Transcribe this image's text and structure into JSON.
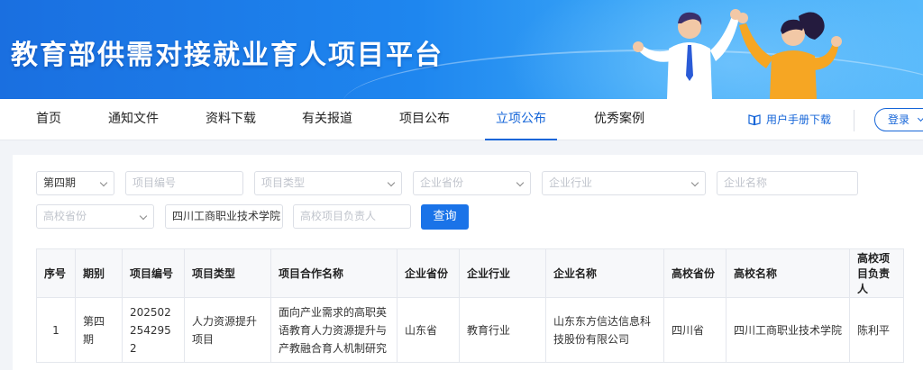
{
  "banner": {
    "title": "教育部供需对接就业育人项目平台"
  },
  "nav": {
    "items": [
      {
        "label": "首页"
      },
      {
        "label": "通知文件"
      },
      {
        "label": "资料下载"
      },
      {
        "label": "有关报道"
      },
      {
        "label": "项目公布"
      },
      {
        "label": "立项公布",
        "active": true
      },
      {
        "label": "优秀案例"
      }
    ],
    "manual_label": "用户手册下载",
    "manual_icon": "book-icon",
    "login_label": "登录"
  },
  "filters": {
    "period": {
      "value": "第四期"
    },
    "project_no": {
      "placeholder": "项目编号"
    },
    "project_type": {
      "placeholder": "项目类型"
    },
    "company_province": {
      "placeholder": "企业省份"
    },
    "company_industry": {
      "placeholder": "企业行业"
    },
    "company_name": {
      "placeholder": "企业名称"
    },
    "school_province": {
      "placeholder": "高校省份"
    },
    "school_name": {
      "value": "四川工商职业技术学院"
    },
    "school_leader": {
      "placeholder": "高校项目负责人"
    },
    "query_label": "查询"
  },
  "table": {
    "headers": [
      "序号",
      "期别",
      "项目编号",
      "项目类型",
      "项目合作名称",
      "企业省份",
      "企业行业",
      "企业名称",
      "高校省份",
      "高校名称",
      "高校项目负责人"
    ],
    "rows": [
      [
        "1",
        "第四期",
        "2025022542952",
        "人力资源提升项目",
        "面向产业需求的高职英语教育人力资源提升与产教融合育人机制研究",
        "山东省",
        "教育行业",
        "山东东方信达信息科技股份有限公司",
        "四川省",
        "四川工商职业技术学院",
        "陈利平"
      ]
    ]
  },
  "colors": {
    "primary": "#1565d8",
    "banner": "#1e86ef"
  }
}
